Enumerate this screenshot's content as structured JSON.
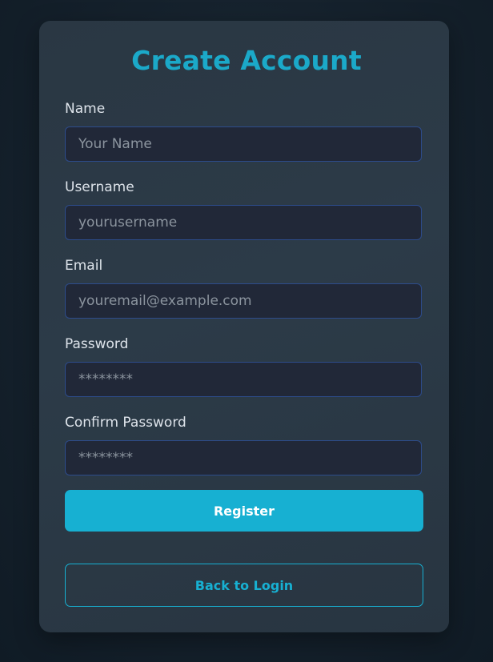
{
  "form": {
    "title": "Create Account",
    "background_glow_text": "",
    "fields": [
      {
        "label": "Name",
        "value": "",
        "placeholder": "Your Name",
        "type": "text"
      },
      {
        "label": "Username",
        "value": "",
        "placeholder": "yourusername",
        "type": "text"
      },
      {
        "label": "Email",
        "value": "",
        "placeholder": "youremail@example.com",
        "type": "email"
      },
      {
        "label": "Password",
        "value": "",
        "placeholder": "********",
        "type": "password"
      },
      {
        "label": "Confirm Password",
        "value": "",
        "placeholder": "********",
        "type": "password"
      }
    ],
    "register_label": "Register",
    "back_label": "Back to Login"
  },
  "colors": {
    "accent": "#17b0d2",
    "page_background": "#15212c",
    "card_background": "#2c3b48",
    "input_background": "#212838",
    "input_border": "#2d4c8c",
    "label_text": "#dde3ea",
    "placeholder_text": "#8b949e"
  }
}
